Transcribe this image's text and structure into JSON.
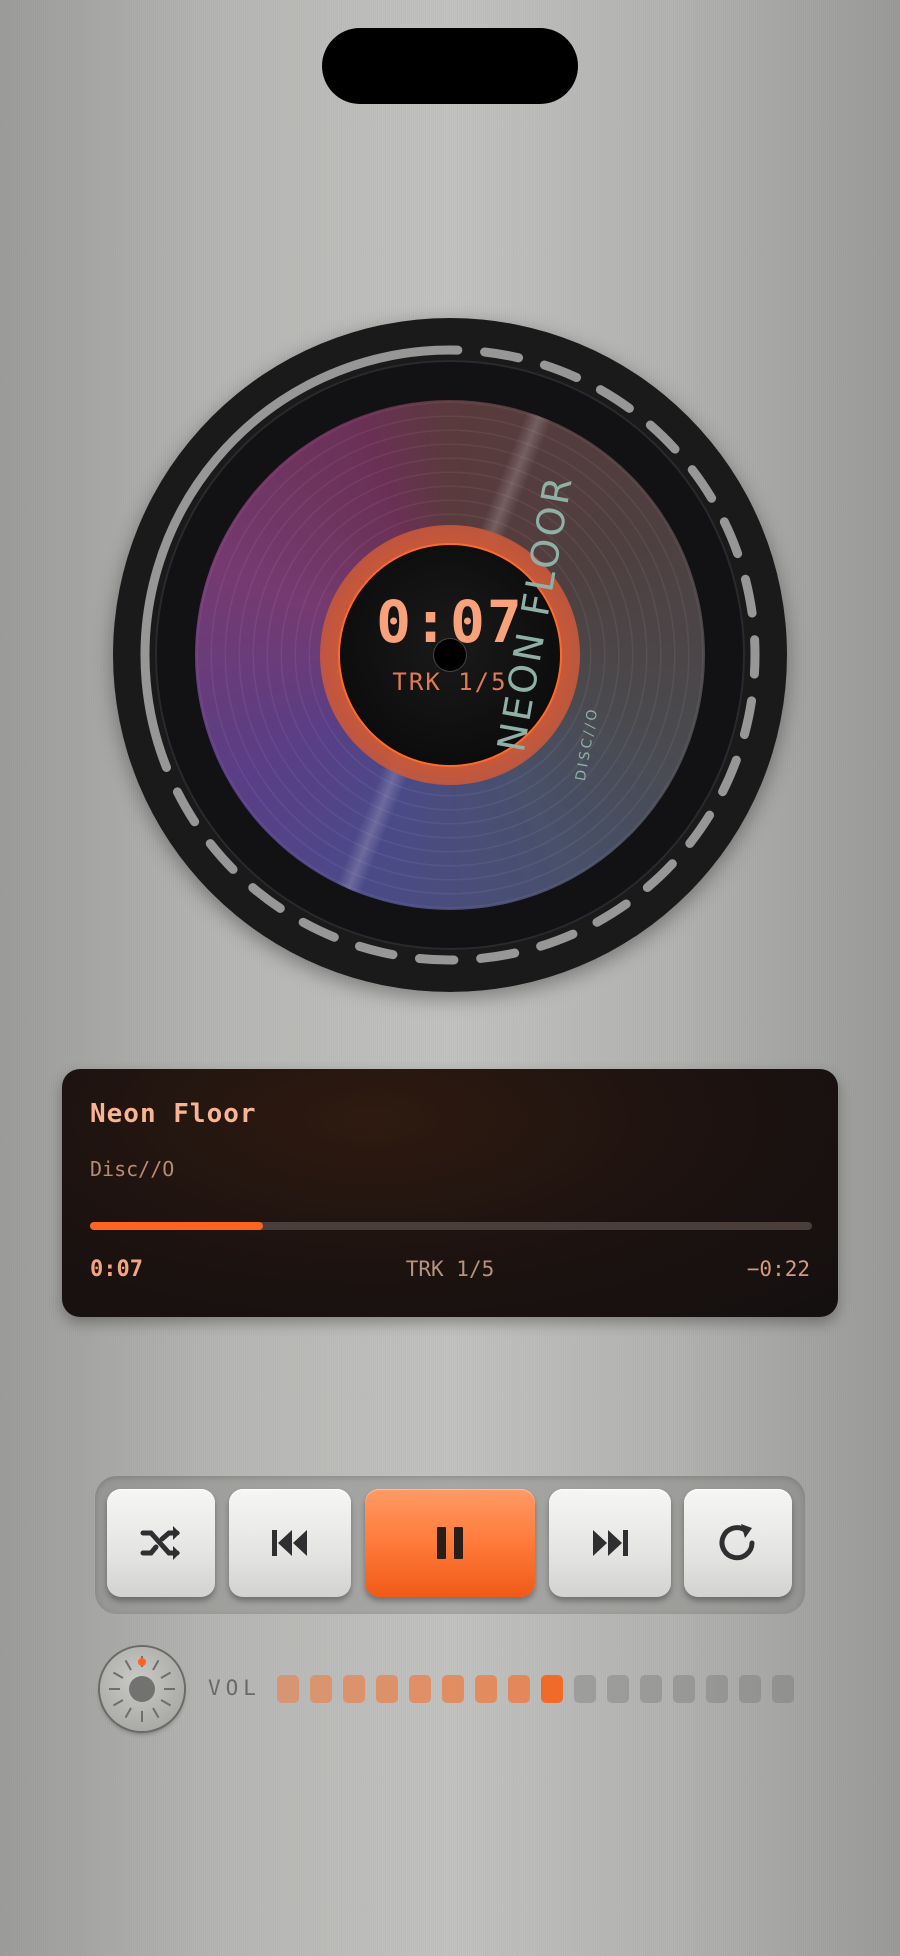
{
  "disc": {
    "time": "0:07",
    "track": "TRK 1/5",
    "title": "NEON FLOOR",
    "subtitle": "DISC//O"
  },
  "now_playing": {
    "title": "Neon Floor",
    "artist": "Disc//O",
    "elapsed": "0:07",
    "track": "TRK 1/5",
    "remaining": "−0:22",
    "progress": 0.24
  },
  "controls": [
    {
      "name": "shuffle-button",
      "icon": "shuffle-icon"
    },
    {
      "name": "previous-button",
      "icon": "skip-back-icon"
    },
    {
      "name": "pause-button",
      "icon": "pause-icon"
    },
    {
      "name": "next-button",
      "icon": "skip-forward-icon"
    },
    {
      "name": "repeat-button",
      "icon": "repeat-icon"
    }
  ],
  "volume": {
    "label": "VOL",
    "level": 9,
    "segments": 16
  },
  "colors": {
    "accent": "#ff6320",
    "accent_text": "#f6a480",
    "panel_bg": "#1c1210"
  }
}
